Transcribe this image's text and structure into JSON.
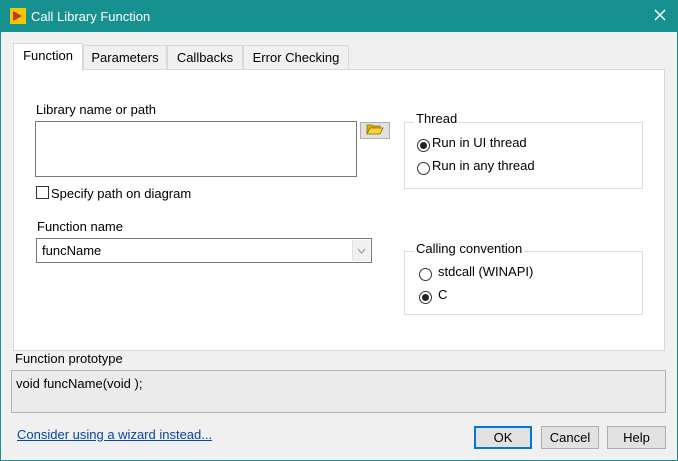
{
  "window": {
    "title": "Call Library Function"
  },
  "tabs": [
    {
      "label": "Function",
      "active": true
    },
    {
      "label": "Parameters",
      "active": false
    },
    {
      "label": "Callbacks",
      "active": false
    },
    {
      "label": "Error Checking",
      "active": false
    }
  ],
  "library": {
    "label": "Library name or path",
    "value": "",
    "specify_path_label": "Specify path on diagram",
    "specify_path_checked": false
  },
  "function": {
    "label": "Function name",
    "value": "funcName"
  },
  "thread": {
    "title": "Thread",
    "options": [
      {
        "label": "Run in UI thread",
        "checked": true
      },
      {
        "label": "Run in any thread",
        "checked": false
      }
    ]
  },
  "calling_convention": {
    "title": "Calling convention",
    "options": [
      {
        "label": "stdcall (WINAPI)",
        "checked": false
      },
      {
        "label": "C",
        "checked": true
      }
    ]
  },
  "prototype": {
    "label": "Function prototype",
    "value": "void  funcName(void );"
  },
  "footer": {
    "wizard_link": "Consider using a wizard instead...",
    "ok_label": "OK",
    "cancel_label": "Cancel",
    "help_label": "Help"
  },
  "colors": {
    "titlebar": "#17918f",
    "link": "#0645ad",
    "default_button_border": "#0078d7"
  }
}
